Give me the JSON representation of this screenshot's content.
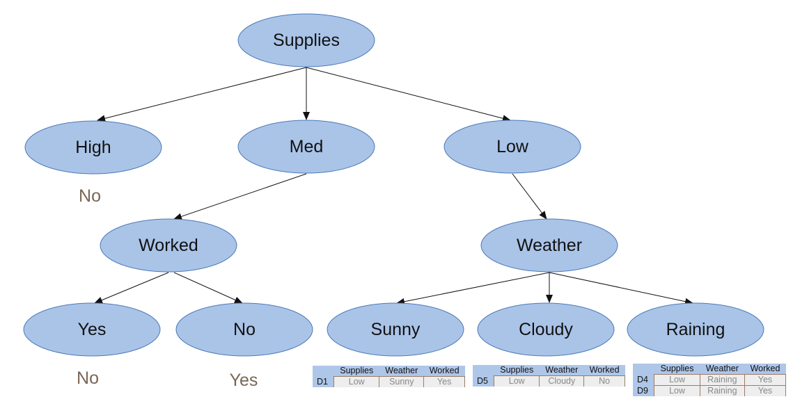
{
  "tree": {
    "root": "Supplies",
    "level1": [
      "High",
      "Med",
      "Low"
    ],
    "high_outcome": "No",
    "med_child": "Worked",
    "low_child": "Weather",
    "worked_branches": [
      "Yes",
      "No"
    ],
    "worked_outcomes": [
      "No",
      "Yes"
    ],
    "weather_branches": [
      "Sunny",
      "Cloudy",
      "Raining"
    ]
  },
  "tables": [
    {
      "headers": [
        "Supplies",
        "Weather",
        "Worked"
      ],
      "rows": [
        {
          "id": "D1",
          "cells": [
            "Low",
            "Sunny",
            "Yes"
          ]
        }
      ]
    },
    {
      "headers": [
        "Supplies",
        "Weather",
        "Worked"
      ],
      "rows": [
        {
          "id": "D5",
          "cells": [
            "Low",
            "Cloudy",
            "No"
          ]
        }
      ]
    },
    {
      "headers": [
        "Supplies",
        "Weather",
        "Worked"
      ],
      "rows": [
        {
          "id": "D4",
          "cells": [
            "Low",
            "Raining",
            "Yes"
          ]
        },
        {
          "id": "D9",
          "cells": [
            "Low",
            "Raining",
            "Yes"
          ]
        }
      ]
    }
  ],
  "colors": {
    "node_fill": "#aac4e8",
    "node_stroke": "#4a79b8",
    "leaf_text": "#7a6656",
    "table_header": "#aec6e8"
  }
}
